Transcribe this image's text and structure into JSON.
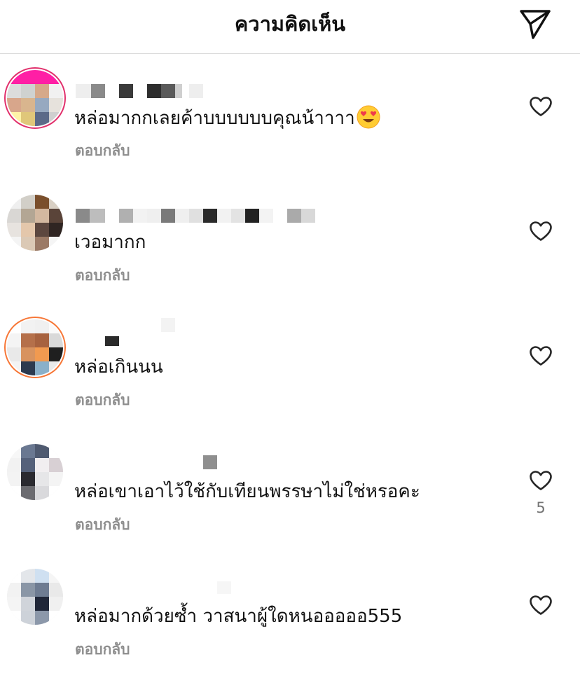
{
  "header": {
    "title": "ความคิดเห็น",
    "share_icon": "paper-plane-icon"
  },
  "comments": [
    {
      "text": "หล่อมากกเลยค้าบบบบบบคุณน้าาาา",
      "emoji": "smiling-face-with-heart-eyes",
      "reply_label": "ตอบกลับ",
      "like_icon": "heart-outline-icon",
      "like_count": "",
      "username_censored": true
    },
    {
      "text": "เวอมากก",
      "reply_label": "ตอบกลับ",
      "like_icon": "heart-outline-icon",
      "like_count": "",
      "username_censored": true
    },
    {
      "text": "หล่อเกินนน",
      "reply_label": "ตอบกลับ",
      "like_icon": "heart-outline-icon",
      "like_count": "",
      "username_censored": true
    },
    {
      "text": "หล่อเขาเอาไว้ใช้กับเทียนพรรษาไม่ใช่หรอคะ",
      "reply_label": "ตอบกลับ",
      "like_icon": "heart-outline-icon",
      "like_count": "5",
      "username_censored": true
    },
    {
      "text": "หล่อมากด้วยซ้ำ วาสนาผู้ใดหนอออออ555",
      "reply_label": "ตอบกลับ",
      "like_icon": "heart-outline-icon",
      "like_count": "",
      "username_censored": true
    }
  ],
  "colors": {
    "text": "#111111",
    "secondary": "#8e8e8e",
    "divider": "#dbdbdb",
    "story_ring": "#e1306c"
  }
}
